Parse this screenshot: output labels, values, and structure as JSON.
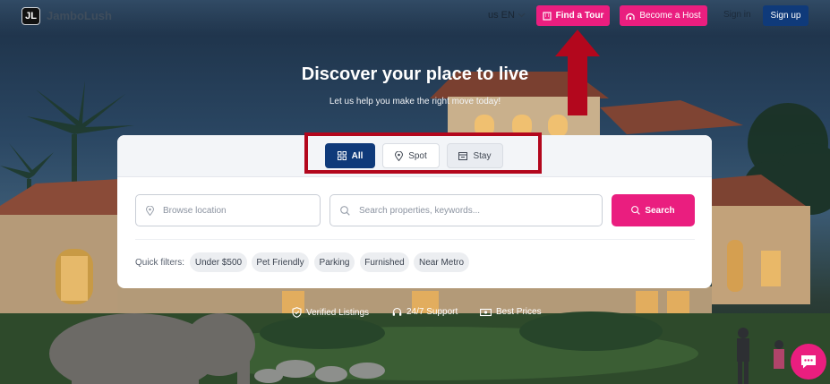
{
  "brand": {
    "logo_glyph": "JL",
    "name": "JamboLush"
  },
  "nav": {
    "language_code": "EN",
    "language_prefix": "us",
    "find_tour_label": "Find a Tour",
    "become_host_label": "Become a Host",
    "sign_in_label": "Sign in",
    "sign_up_label": "Sign up"
  },
  "hero": {
    "title": "Discover your place to live",
    "subtitle": "Let us help you make the right move today!"
  },
  "search": {
    "tabs": [
      {
        "label": "All",
        "icon": "grid-icon",
        "selected": true
      },
      {
        "label": "Spot",
        "icon": "map-pin-icon",
        "selected": false
      },
      {
        "label": "Stay",
        "icon": "calendar-icon",
        "selected": false
      }
    ],
    "location_placeholder": "Browse location",
    "keyword_placeholder": "Search properties, keywords...",
    "search_button_label": "Search",
    "quick_filters_label": "Quick filters:",
    "quick_filters": [
      "Under $500",
      "Pet Friendly",
      "Parking",
      "Furnished",
      "Near Metro"
    ]
  },
  "features": [
    {
      "label": "Verified Listings",
      "icon": "shield-check-icon"
    },
    {
      "label": "24/7 Support",
      "icon": "headset-icon"
    },
    {
      "label": "Best Prices",
      "icon": "money-icon"
    }
  ],
  "colors": {
    "accent_pink": "#ea1e7f",
    "navy": "#0f3a7a",
    "annotation_red": "#b3071d"
  }
}
